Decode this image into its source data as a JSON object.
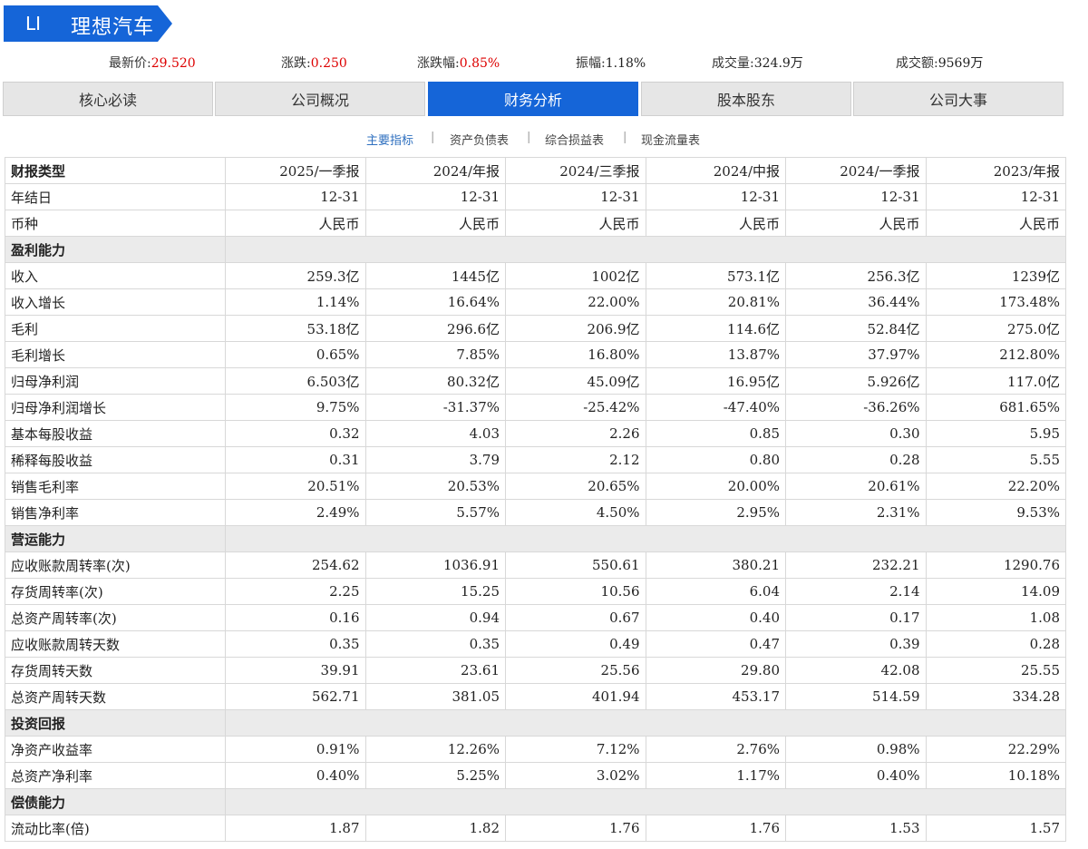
{
  "header": {
    "ticker": "LI",
    "company": "理想汽车",
    "badge_color": "#1565d8"
  },
  "quote": [
    {
      "label": "最新价:",
      "value": "29.520",
      "up": true
    },
    {
      "label": "涨跌:",
      "value": "0.250",
      "up": true
    },
    {
      "label": "涨跌幅:",
      "value": "0.85%",
      "up": true
    },
    {
      "label": "振幅:",
      "value": "1.18%",
      "up": false
    },
    {
      "label": "成交量:",
      "value": "324.9万",
      "up": false
    },
    {
      "label": "成交额:",
      "value": "9569万",
      "up": false
    }
  ],
  "tabs": [
    {
      "label": "核心必读",
      "active": false
    },
    {
      "label": "公司概况",
      "active": false
    },
    {
      "label": "财务分析",
      "active": true
    },
    {
      "label": "股本股东",
      "active": false
    },
    {
      "label": "公司大事",
      "active": false
    }
  ],
  "subnav": [
    {
      "label": "主要指标",
      "active": true
    },
    {
      "label": "资产负债表",
      "active": false
    },
    {
      "label": "综合损益表",
      "active": false
    },
    {
      "label": "现金流量表",
      "active": false
    }
  ],
  "table": {
    "header": [
      "财报类型",
      "2025/一季报",
      "2024/年报",
      "2024/三季报",
      "2024/中报",
      "2024/一季报",
      "2023/年报"
    ],
    "rows": [
      {
        "type": "data",
        "cells": [
          "年结日",
          "12-31",
          "12-31",
          "12-31",
          "12-31",
          "12-31",
          "12-31"
        ]
      },
      {
        "type": "data",
        "cells": [
          "币种",
          "人民币",
          "人民币",
          "人民币",
          "人民币",
          "人民币",
          "人民币"
        ]
      },
      {
        "type": "section",
        "cells": [
          "盈利能力"
        ]
      },
      {
        "type": "data",
        "cells": [
          "收入",
          "259.3亿",
          "1445亿",
          "1002亿",
          "573.1亿",
          "256.3亿",
          "1239亿"
        ]
      },
      {
        "type": "data",
        "cells": [
          "收入增长",
          "1.14%",
          "16.64%",
          "22.00%",
          "20.81%",
          "36.44%",
          "173.48%"
        ]
      },
      {
        "type": "data",
        "cells": [
          "毛利",
          "53.18亿",
          "296.6亿",
          "206.9亿",
          "114.6亿",
          "52.84亿",
          "275.0亿"
        ]
      },
      {
        "type": "data",
        "cells": [
          "毛利增长",
          "0.65%",
          "7.85%",
          "16.80%",
          "13.87%",
          "37.97%",
          "212.80%"
        ]
      },
      {
        "type": "data",
        "cells": [
          "归母净利润",
          "6.503亿",
          "80.32亿",
          "45.09亿",
          "16.95亿",
          "5.926亿",
          "117.0亿"
        ]
      },
      {
        "type": "data",
        "cells": [
          "归母净利润增长",
          "9.75%",
          "-31.37%",
          "-25.42%",
          "-47.40%",
          "-36.26%",
          "681.65%"
        ]
      },
      {
        "type": "data",
        "cells": [
          "基本每股收益",
          "0.32",
          "4.03",
          "2.26",
          "0.85",
          "0.30",
          "5.95"
        ]
      },
      {
        "type": "data",
        "cells": [
          "稀释每股收益",
          "0.31",
          "3.79",
          "2.12",
          "0.80",
          "0.28",
          "5.55"
        ]
      },
      {
        "type": "data",
        "cells": [
          "销售毛利率",
          "20.51%",
          "20.53%",
          "20.65%",
          "20.00%",
          "20.61%",
          "22.20%"
        ]
      },
      {
        "type": "data",
        "cells": [
          "销售净利率",
          "2.49%",
          "5.57%",
          "4.50%",
          "2.95%",
          "2.31%",
          "9.53%"
        ]
      },
      {
        "type": "section",
        "cells": [
          "营运能力"
        ]
      },
      {
        "type": "data",
        "cells": [
          "应收账款周转率(次)",
          "254.62",
          "1036.91",
          "550.61",
          "380.21",
          "232.21",
          "1290.76"
        ]
      },
      {
        "type": "data",
        "cells": [
          "存货周转率(次)",
          "2.25",
          "15.25",
          "10.56",
          "6.04",
          "2.14",
          "14.09"
        ]
      },
      {
        "type": "data",
        "cells": [
          "总资产周转率(次)",
          "0.16",
          "0.94",
          "0.67",
          "0.40",
          "0.17",
          "1.08"
        ]
      },
      {
        "type": "data",
        "cells": [
          "应收账款周转天数",
          "0.35",
          "0.35",
          "0.49",
          "0.47",
          "0.39",
          "0.28"
        ]
      },
      {
        "type": "data",
        "cells": [
          "存货周转天数",
          "39.91",
          "23.61",
          "25.56",
          "29.80",
          "42.08",
          "25.55"
        ]
      },
      {
        "type": "data",
        "cells": [
          "总资产周转天数",
          "562.71",
          "381.05",
          "401.94",
          "453.17",
          "514.59",
          "334.28"
        ]
      },
      {
        "type": "section",
        "cells": [
          "投资回报"
        ]
      },
      {
        "type": "data",
        "cells": [
          "净资产收益率",
          "0.91%",
          "12.26%",
          "7.12%",
          "2.76%",
          "0.98%",
          "22.29%"
        ]
      },
      {
        "type": "data",
        "cells": [
          "总资产净利率",
          "0.40%",
          "5.25%",
          "3.02%",
          "1.17%",
          "0.40%",
          "10.18%"
        ]
      },
      {
        "type": "section",
        "cells": [
          "偿债能力"
        ]
      },
      {
        "type": "data",
        "cells": [
          "流动比率(倍)",
          "1.87",
          "1.82",
          "1.76",
          "1.76",
          "1.53",
          "1.57"
        ]
      }
    ]
  }
}
